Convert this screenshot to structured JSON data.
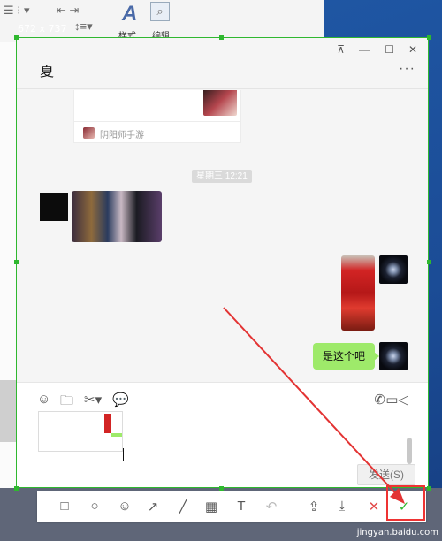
{
  "screenshot": {
    "dimension_label": "672 x 737",
    "watermark": "jingyan.baidu.com"
  },
  "ribbon": {
    "style_label": "样式",
    "edit_label": "编辑"
  },
  "chat": {
    "title": "夏",
    "shared_card": {
      "app_name": "阴阳师手游"
    },
    "timestamp": "星期三 12:21",
    "sent_text": "是这个吧",
    "send_button": "发送(S)"
  },
  "colors": {
    "accent": "#2fb82f",
    "bubble": "#9eea6a",
    "annotation": "#e33333"
  }
}
